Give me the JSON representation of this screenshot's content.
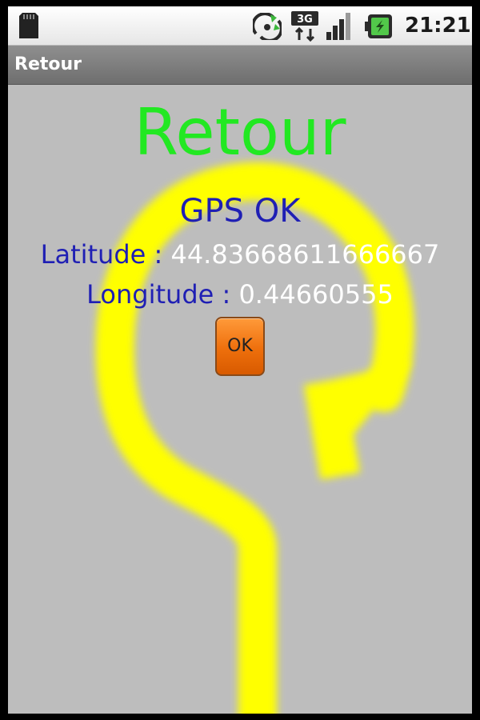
{
  "status_bar": {
    "time": "21:21",
    "icons": [
      "sd-card-icon",
      "sync-icon",
      "3g-network-icon",
      "signal-strength-icon",
      "battery-charging-icon"
    ],
    "network_label": "3G"
  },
  "title_bar": {
    "title": "Retour"
  },
  "main": {
    "heading": "Retour",
    "gps_status": "GPS OK",
    "latitude_label": "Latitude :",
    "latitude_value": "44.83668611666667",
    "longitude_label": "Longitude :",
    "longitude_value": "0.44660555",
    "ok_button_label": "OK",
    "background_graphic": "return-arrow-icon"
  },
  "colors": {
    "heading": "#22e822",
    "labels": "#1f1fb4",
    "values": "#ffffff",
    "button": "#ee6f0c",
    "arrow": "#ffff00",
    "background": "#bdbdbd"
  }
}
